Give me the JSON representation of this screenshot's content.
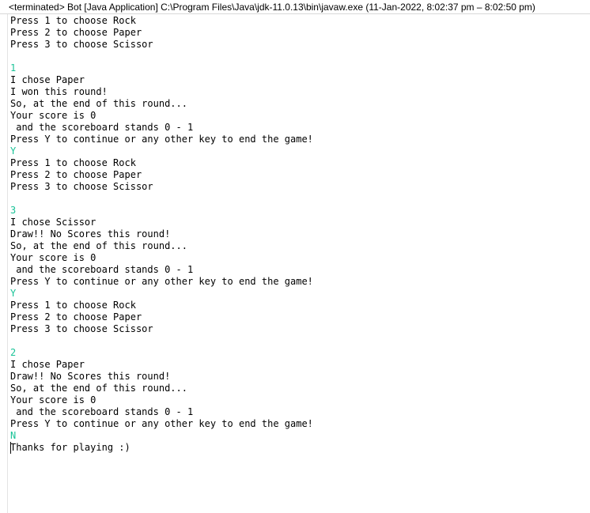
{
  "window": {
    "title": "<terminated> Bot [Java Application] C:\\Program Files\\Java\\jdk-11.0.13\\bin\\javaw.exe  (11-Jan-2022, 8:02:37 pm – 8:02:50 pm)"
  },
  "colors": {
    "user_input": "#19c397",
    "program_output": "#000000",
    "background": "#ffffff"
  },
  "console": {
    "lines": [
      {
        "text": "Press 1 to choose Rock",
        "kind": "output"
      },
      {
        "text": "Press 2 to choose Paper",
        "kind": "output"
      },
      {
        "text": "Press 3 to choose Scissor",
        "kind": "output"
      },
      {
        "text": "",
        "kind": "output"
      },
      {
        "text": "1",
        "kind": "input"
      },
      {
        "text": "I chose Paper",
        "kind": "output"
      },
      {
        "text": "I won this round!",
        "kind": "output"
      },
      {
        "text": "So, at the end of this round...",
        "kind": "output"
      },
      {
        "text": "Your score is 0",
        "kind": "output"
      },
      {
        "text": " and the scoreboard stands 0 - 1",
        "kind": "output"
      },
      {
        "text": "Press Y to continue or any other key to end the game!",
        "kind": "output"
      },
      {
        "text": "Y",
        "kind": "input"
      },
      {
        "text": "Press 1 to choose Rock",
        "kind": "output"
      },
      {
        "text": "Press 2 to choose Paper",
        "kind": "output"
      },
      {
        "text": "Press 3 to choose Scissor",
        "kind": "output"
      },
      {
        "text": "",
        "kind": "output"
      },
      {
        "text": "3",
        "kind": "input"
      },
      {
        "text": "I chose Scissor",
        "kind": "output"
      },
      {
        "text": "Draw!! No Scores this round!",
        "kind": "output"
      },
      {
        "text": "So, at the end of this round...",
        "kind": "output"
      },
      {
        "text": "Your score is 0",
        "kind": "output"
      },
      {
        "text": " and the scoreboard stands 0 - 1",
        "kind": "output"
      },
      {
        "text": "Press Y to continue or any other key to end the game!",
        "kind": "output"
      },
      {
        "text": "Y",
        "kind": "input"
      },
      {
        "text": "Press 1 to choose Rock",
        "kind": "output"
      },
      {
        "text": "Press 2 to choose Paper",
        "kind": "output"
      },
      {
        "text": "Press 3 to choose Scissor",
        "kind": "output"
      },
      {
        "text": "",
        "kind": "output"
      },
      {
        "text": "2",
        "kind": "input"
      },
      {
        "text": "I chose Paper",
        "kind": "output"
      },
      {
        "text": "Draw!! No Scores this round!",
        "kind": "output"
      },
      {
        "text": "So, at the end of this round...",
        "kind": "output"
      },
      {
        "text": "Your score is 0",
        "kind": "output"
      },
      {
        "text": " and the scoreboard stands 0 - 1",
        "kind": "output"
      },
      {
        "text": "Press Y to continue or any other key to end the game!",
        "kind": "output"
      },
      {
        "text": "N",
        "kind": "input"
      },
      {
        "text": "Thanks for playing :)",
        "kind": "output"
      }
    ]
  }
}
